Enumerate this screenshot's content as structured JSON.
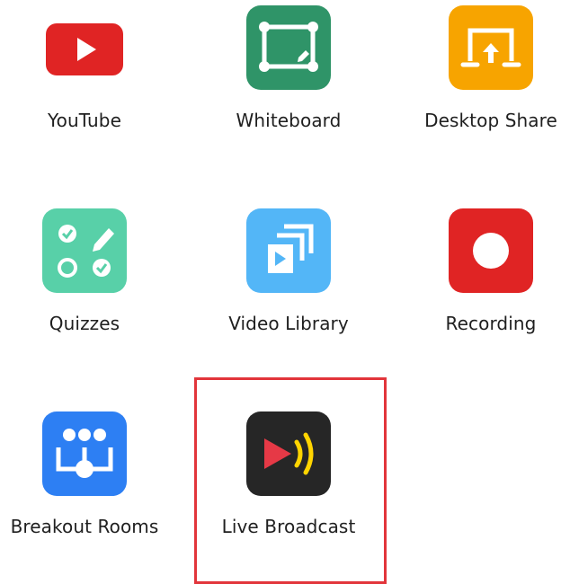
{
  "apps": [
    {
      "label": "YouTube",
      "icon": "youtube-icon",
      "color": "#e02424"
    },
    {
      "label": "Whiteboard",
      "icon": "whiteboard-icon",
      "color": "#2f9468"
    },
    {
      "label": "Desktop Share",
      "icon": "desktop-share-icon",
      "color": "#f7a400"
    },
    {
      "label": "Quizzes",
      "icon": "quizzes-icon",
      "color": "#58d0a8"
    },
    {
      "label": "Video Library",
      "icon": "video-library-icon",
      "color": "#53b6f7"
    },
    {
      "label": "Recording",
      "icon": "recording-icon",
      "color": "#e02424"
    },
    {
      "label": "Breakout Rooms",
      "icon": "breakout-rooms-icon",
      "color": "#2d7ff3"
    },
    {
      "label": "Live Broadcast",
      "icon": "live-broadcast-icon",
      "color": "#262626"
    }
  ],
  "highlight": {
    "color": "#e2353b",
    "target": "Live Broadcast"
  }
}
